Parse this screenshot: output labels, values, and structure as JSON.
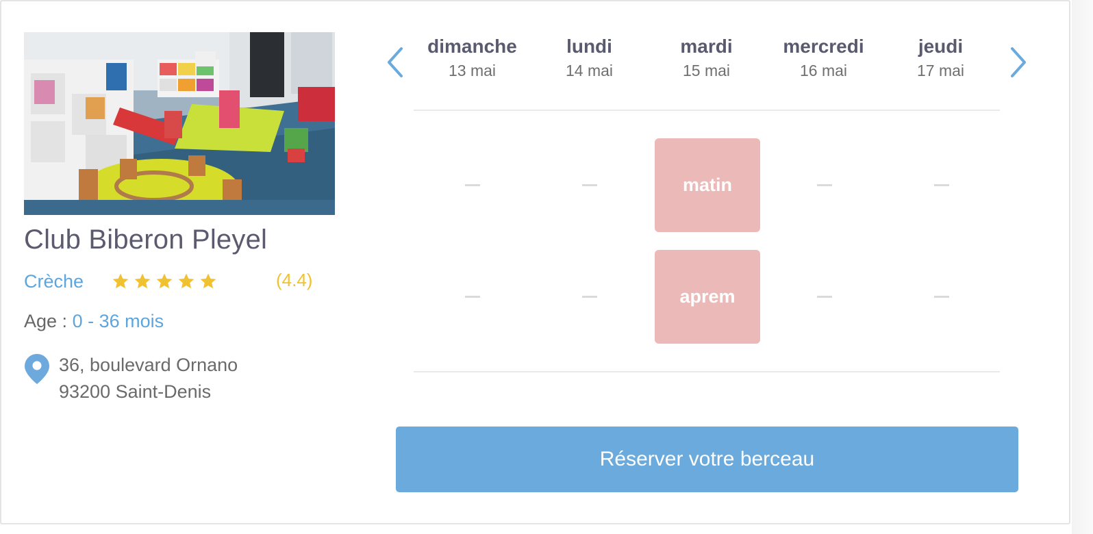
{
  "nursery": {
    "name": "Club Biberon Pleyel",
    "type": "Crèche",
    "rating_text": "(4.4)",
    "rating_value": 4.4,
    "stars_total": 5,
    "age_label": "Age :",
    "age_range": "0 - 36 mois",
    "address_line1": "36, boulevard Ornano",
    "address_line2": "93200 Saint-Denis"
  },
  "calendar": {
    "days": [
      {
        "name": "dimanche",
        "date": "13 mai",
        "morning": "",
        "afternoon": ""
      },
      {
        "name": "lundi",
        "date": "14 mai",
        "morning": "",
        "afternoon": ""
      },
      {
        "name": "mardi",
        "date": "15 mai",
        "morning": "matin",
        "afternoon": "aprem"
      },
      {
        "name": "mercredi",
        "date": "16 mai",
        "morning": "",
        "afternoon": ""
      },
      {
        "name": "jeudi",
        "date": "17 mai",
        "morning": "",
        "afternoon": ""
      }
    ]
  },
  "booking": {
    "button_label": "Réserver votre berceau"
  },
  "icons": {
    "prev": "chevron-left-icon",
    "next": "chevron-right-icon",
    "location": "map-pin-icon",
    "star": "star-icon"
  },
  "colors": {
    "accent_blue": "#6aaadd",
    "link_blue": "#5da5dc",
    "slot_pink": "#ebbab8",
    "star_yellow": "#f0c232",
    "title_gray": "#5b5a6e"
  }
}
